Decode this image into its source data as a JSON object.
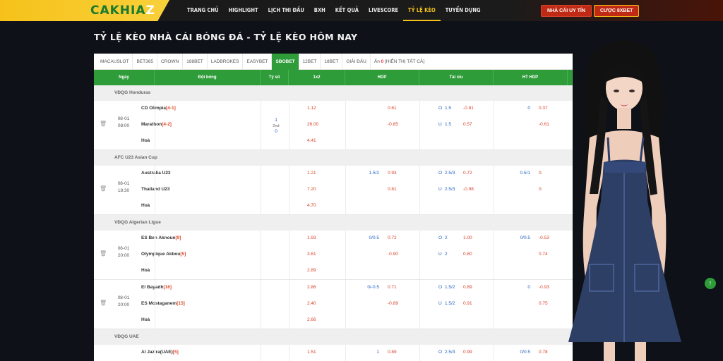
{
  "header": {
    "logo_main": "CAKHIA",
    "logo_z": "Z",
    "nav": [
      "TRANG CHỦ",
      "HIGHLIGHT",
      "LỊCH THI ĐẤU",
      "BXH",
      "KẾT QUẢ",
      "LIVESCORE",
      "TỶ LỆ KÈO",
      "TUYỂN DỤNG"
    ],
    "active_nav_index": 6,
    "btn_trusted": "NHÀ CÁI UY TÍN",
    "btn_bet": "CƯỢC 8XBET"
  },
  "page_title": "TỶ LỆ KÈO NHÀ CÁI BÓNG ĐÁ - TỶ LỆ KÈO HÔM NAY",
  "tabs": [
    "MACAUSLOT",
    "BET365",
    "CROWN",
    "188BET",
    "LADBROKES",
    "EASYBET",
    "SBOBET",
    "12BET",
    "18BET",
    "GIẢI ĐẤU"
  ],
  "active_tab_index": 6,
  "hide_label": "Ẩn",
  "hide_count": "0",
  "show_all": "[HIỂN THỊ TẤT CẢ]",
  "columns": [
    "Ngày",
    "Đội bóng",
    "Tỷ số",
    "1x2",
    "HDP",
    "Tài xỉu",
    "HT HDP"
  ],
  "leagues": [
    {
      "name": "VĐQG Honduras",
      "matches": [
        {
          "date": "08-01",
          "time": "08:00",
          "home": "CD Olimpia",
          "home_rank": "[4-1]",
          "away": "Marathon",
          "away_rank": "[4-2]",
          "draw": "Hoà",
          "score_top": "1",
          "score_mid": "2nd",
          "score_bot": "0",
          "x12": [
            "1.12",
            "26.00",
            "4.41"
          ],
          "hdp_line": [
            "",
            ""
          ],
          "hdp_odds": [
            "0.61",
            "-0.85"
          ],
          "ou_label": [
            "O",
            "U"
          ],
          "ou_line": [
            "1.5",
            "1.5"
          ],
          "ou_odds": [
            "-0.81",
            "0.57"
          ],
          "ht_line": [
            "0",
            ""
          ],
          "ht_odds": [
            "0.37",
            "-0.61"
          ]
        }
      ]
    },
    {
      "name": "AFC U23 Asian Cup",
      "matches": [
        {
          "date": "08-01",
          "time": "18:30",
          "home": "Australia U23",
          "home_rank": "",
          "away": "Thailand U23",
          "away_rank": "",
          "draw": "Hoà",
          "score_top": "",
          "score_mid": "",
          "score_bot": "",
          "x12": [
            "1.21",
            "7.20",
            "4.70"
          ],
          "hdp_line": [
            "1.5/2",
            ""
          ],
          "hdp_odds": [
            "0.93",
            "0.81"
          ],
          "ou_label": [
            "O",
            "U"
          ],
          "ou_line": [
            "2.5/3",
            "2.5/3"
          ],
          "ou_odds": [
            "0.72",
            "-0.98"
          ],
          "ht_line": [
            "0.5/1",
            ""
          ],
          "ht_odds": [
            "0.",
            "0."
          ]
        }
      ]
    },
    {
      "name": "VĐQG Algerian Ligue",
      "matches": [
        {
          "date": "08-01",
          "time": "20:00",
          "home": "ES Ben Aknoun",
          "home_rank": "[9]",
          "away": "Olympique Akbou",
          "away_rank": "[5]",
          "draw": "Hoà",
          "score_top": "",
          "score_mid": "",
          "score_bot": "",
          "x12": [
            "1.93",
            "3.61",
            "2.89"
          ],
          "hdp_line": [
            "0/0.5",
            ""
          ],
          "hdp_odds": [
            "0.72",
            "-0.90"
          ],
          "ou_label": [
            "O",
            "U"
          ],
          "ou_line": [
            "2",
            "2"
          ],
          "ou_odds": [
            "1.00",
            "0.80"
          ],
          "ht_line": [
            "0/0.5",
            ""
          ],
          "ht_odds": [
            "-0.53",
            "0.74"
          ]
        },
        {
          "date": "08-01",
          "time": "20:00",
          "home": "El Bayadh",
          "home_rank": "[16]",
          "away": "ES Mostaganem",
          "away_rank": "[15]",
          "draw": "Hoà",
          "score_top": "",
          "score_mid": "",
          "score_bot": "",
          "x12": [
            "2.86",
            "2.40",
            "2.66"
          ],
          "hdp_line": [
            "0/-0.5",
            ""
          ],
          "hdp_odds": [
            "0.71",
            "-0.89"
          ],
          "ou_label": [
            "O",
            "U"
          ],
          "ou_line": [
            "1.5/2",
            "1.5/2"
          ],
          "ou_odds": [
            "0.89",
            "0.91"
          ],
          "ht_line": [
            "0",
            ""
          ],
          "ht_odds": [
            "-0.93",
            "0.75"
          ]
        }
      ]
    },
    {
      "name": "VĐQG UAE",
      "matches": [
        {
          "date": "",
          "time": "",
          "home": "Al Jazira(UAE)",
          "home_rank": "[5]",
          "away": "",
          "away_rank": "",
          "draw": "",
          "score_top": "",
          "score_mid": "",
          "score_bot": "",
          "x12": [
            "1.51",
            "",
            ""
          ],
          "hdp_line": [
            "1",
            ""
          ],
          "hdp_odds": [
            "0.89",
            ""
          ],
          "ou_label": [
            "O",
            ""
          ],
          "ou_line": [
            "2.5/3",
            ""
          ],
          "ou_odds": [
            "0.99",
            ""
          ],
          "ht_line": [
            "0/0.5",
            ""
          ],
          "ht_odds": [
            "0.78",
            ""
          ]
        }
      ]
    }
  ],
  "icons": {
    "trash": "trash-icon",
    "scroll_top": "arrow-up-icon"
  },
  "colors": {
    "green": "#2f9c3a",
    "gold": "#f6c21a",
    "red_odds": "#d9432b",
    "blue_line": "#1f5fbf"
  }
}
